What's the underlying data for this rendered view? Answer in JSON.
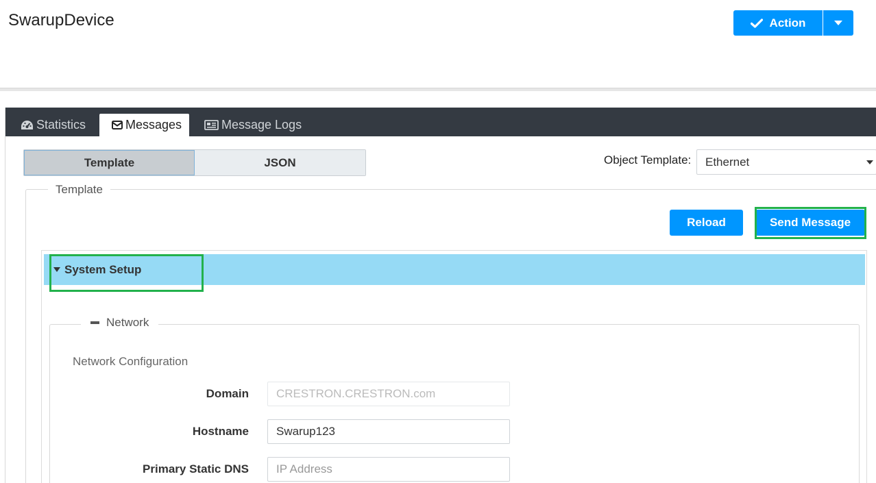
{
  "header": {
    "title": "SwarupDevice",
    "action_label": "Action"
  },
  "tabs": [
    {
      "label": "Statistics",
      "icon": "dashboard-icon"
    },
    {
      "label": "Messages",
      "icon": "envelope-icon",
      "active": true
    },
    {
      "label": "Message Logs",
      "icon": "newspaper-icon"
    }
  ],
  "mode": {
    "template_label": "Template",
    "json_label": "JSON",
    "selected": "Template"
  },
  "object_template": {
    "label": "Object Template:",
    "value": "Ethernet"
  },
  "template_section": {
    "legend": "Template",
    "reload_label": "Reload",
    "send_label": "Send Message"
  },
  "system_setup": {
    "label": "System Setup",
    "network": {
      "legend": "Network",
      "config_title": "Network Configuration",
      "fields": [
        {
          "label": "Domain",
          "value": "CRESTRON.CRESTRON.com",
          "disabled": true
        },
        {
          "label": "Hostname",
          "value": "Swarup123"
        },
        {
          "label": "Primary Static DNS",
          "placeholder": "IP Address"
        }
      ]
    }
  },
  "colors": {
    "primary": "#0096ff",
    "tabbar": "#343a42",
    "section_header": "#96daf5",
    "highlight": "#22b14c"
  }
}
